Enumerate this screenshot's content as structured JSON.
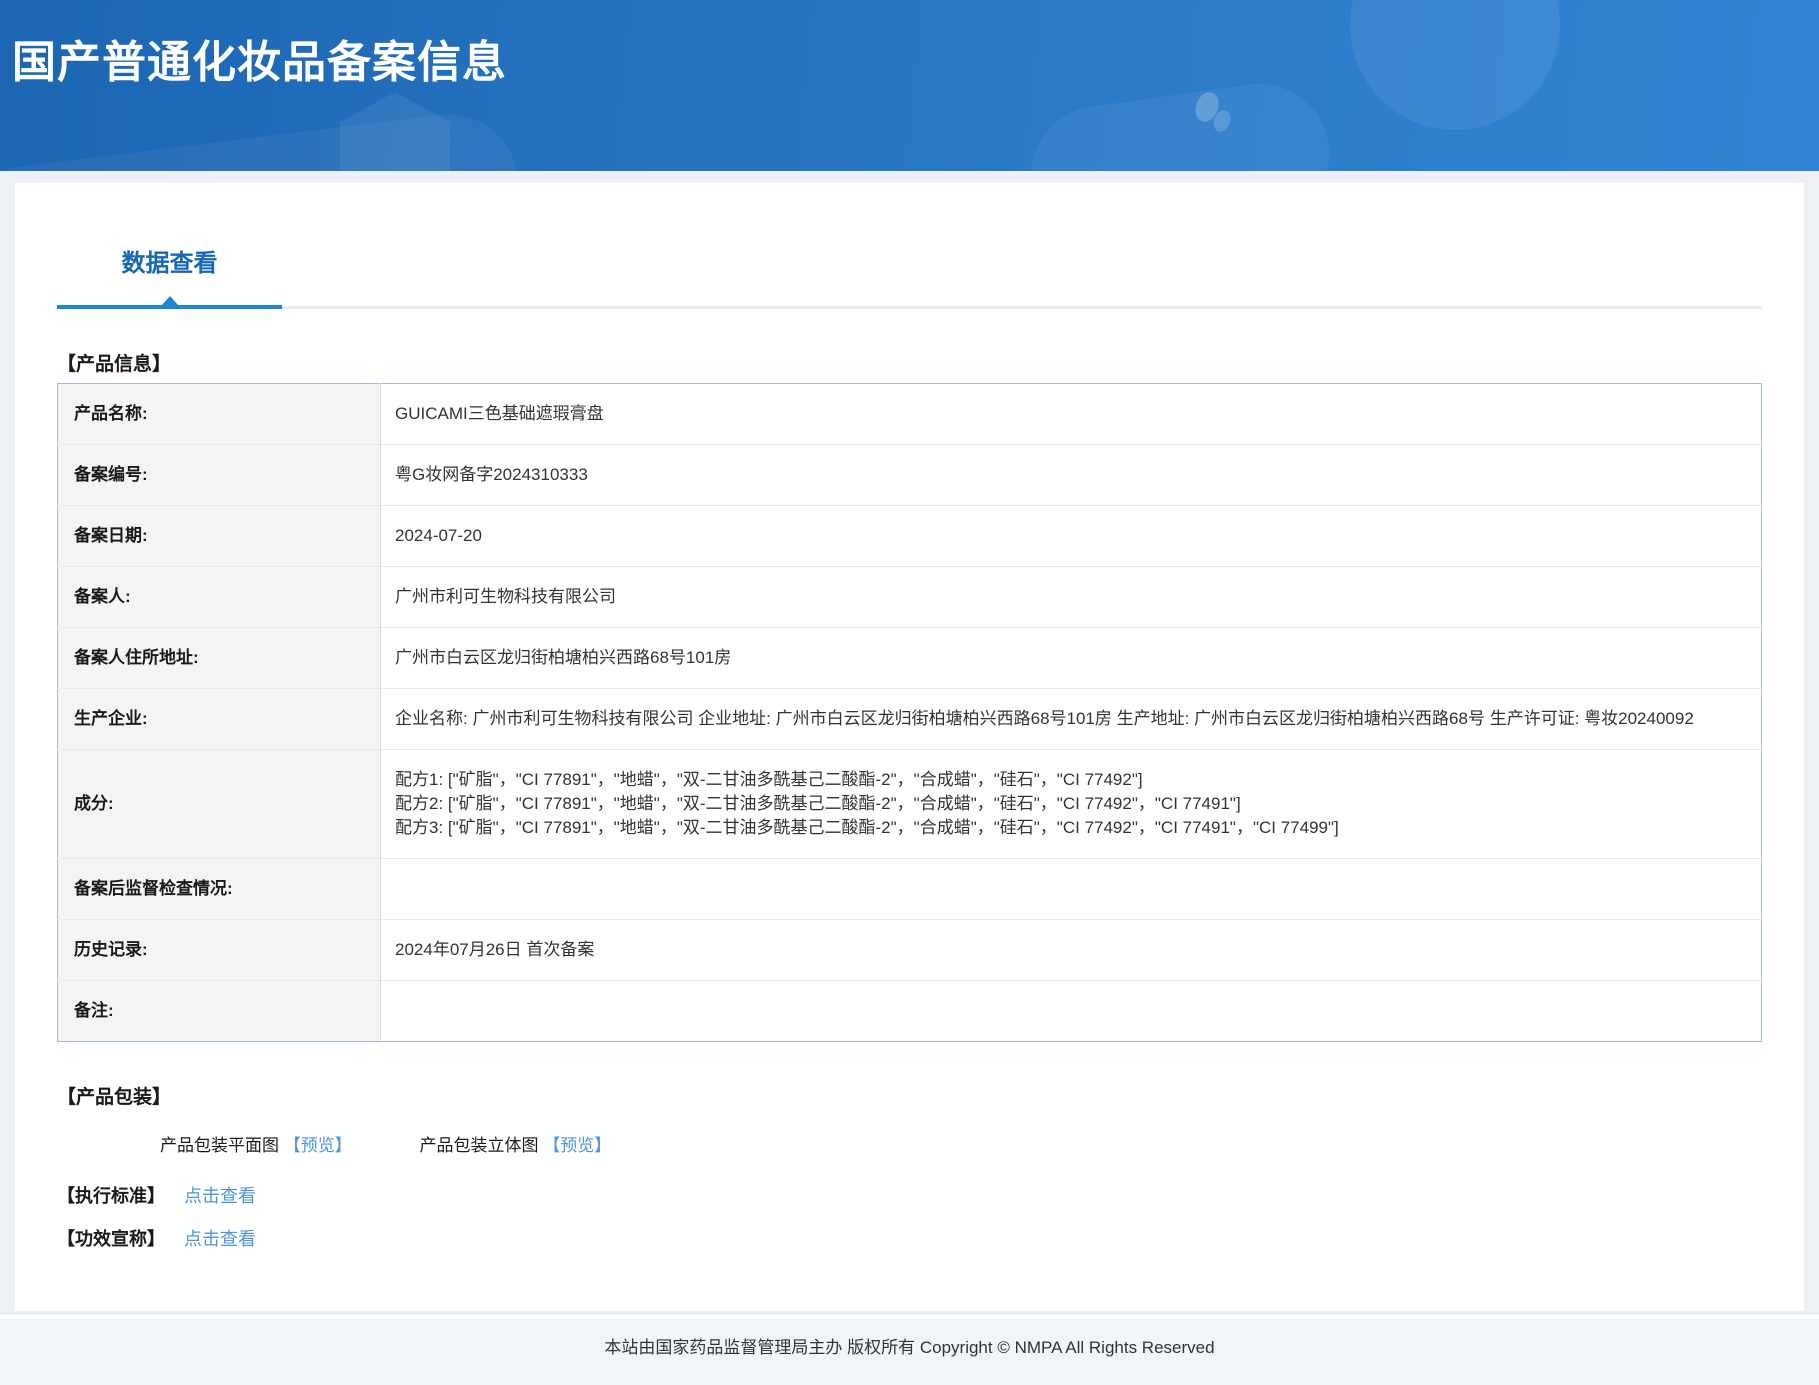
{
  "banner": {
    "title": "国产普通化妆品备案信息"
  },
  "tab": {
    "label": "数据查看"
  },
  "product_info": {
    "heading": "【产品信息】",
    "rows": [
      {
        "label": "产品名称:",
        "value": "GUICAMI三色基础遮瑕膏盘"
      },
      {
        "label": "备案编号:",
        "value": "粤G妆网备字2024310333"
      },
      {
        "label": "备案日期:",
        "value": "2024-07-20"
      },
      {
        "label": "备案人:",
        "value": "广州市利可生物科技有限公司"
      },
      {
        "label": "备案人住所地址:",
        "value": "广州市白云区龙归街柏塘柏兴西路68号101房"
      },
      {
        "label": "生产企业:",
        "value": "企业名称: 广州市利可生物科技有限公司 企业地址: 广州市白云区龙归街柏塘柏兴西路68号101房 生产地址: 广州市白云区龙归街柏塘柏兴西路68号 生产许可证: 粤妆20240092"
      },
      {
        "label": "成分:",
        "value": "配方1: [\"矿脂\"，\"CI 77891\"，\"地蜡\"，\"双-二甘油多酰基己二酸酯-2\"，\"合成蜡\"，\"硅石\"，\"CI 77492\"]\n配方2: [\"矿脂\"，\"CI 77891\"，\"地蜡\"，\"双-二甘油多酰基己二酸酯-2\"，\"合成蜡\"，\"硅石\"，\"CI 77492\"，\"CI 77491\"]\n配方3: [\"矿脂\"，\"CI 77891\"，\"地蜡\"，\"双-二甘油多酰基己二酸酯-2\"，\"合成蜡\"，\"硅石\"，\"CI 77492\"，\"CI 77491\"，\"CI 77499\"]"
      },
      {
        "label": "备案后监督检查情况:",
        "value": ""
      },
      {
        "label": "历史记录:",
        "value": "2024年07月26日 首次备案"
      },
      {
        "label": "备注:",
        "value": ""
      }
    ]
  },
  "packaging": {
    "heading": "【产品包装】",
    "items": [
      {
        "label": "产品包装平面图",
        "link": "【预览】"
      },
      {
        "label": "产品包装立体图 ",
        "link": "【预览】"
      }
    ]
  },
  "standards": {
    "label": "【执行标准】",
    "link": "点击查看"
  },
  "efficacy": {
    "label": "【功效宣称】",
    "link": "点击查看"
  },
  "footer": {
    "text": "本站由国家药品监督管理局主办 版权所有 Copyright © NMPA All Rights Reserved"
  },
  "colors": {
    "banner_start": "#1c66b2",
    "banner_end": "#3284d4",
    "tab_text": "#1667b5",
    "tab_underline": "#1e87d5",
    "link_blue": "#4f94d9",
    "table_border": "#a3bcd9",
    "label_bg": "#f4f4f4",
    "page_bg": "#edf0f4"
  }
}
